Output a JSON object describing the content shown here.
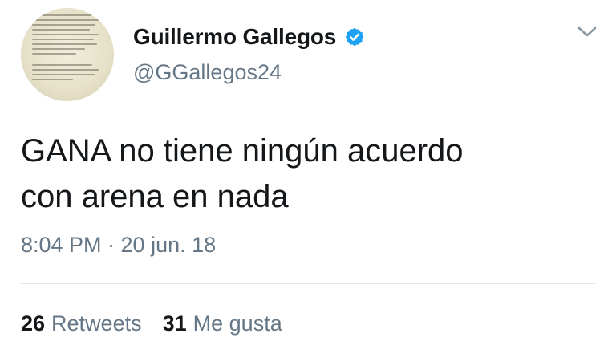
{
  "profile": {
    "name": "Guillermo Gallegos",
    "handle": "@GGallegos24",
    "verified": true
  },
  "tweet": {
    "text_line1": "GANA no tiene ningún acuerdo",
    "text_line2": "con arena en nada",
    "timestamp": "8:04 PM · 20 jun. 18"
  },
  "stats": {
    "retweets_count": "26",
    "retweets_label": "Retweets",
    "likes_count": "31",
    "likes_label": "Me gusta"
  },
  "colors": {
    "verified_badge": "#1da1f2",
    "secondary_text": "#657786",
    "primary_text": "#14171a"
  }
}
